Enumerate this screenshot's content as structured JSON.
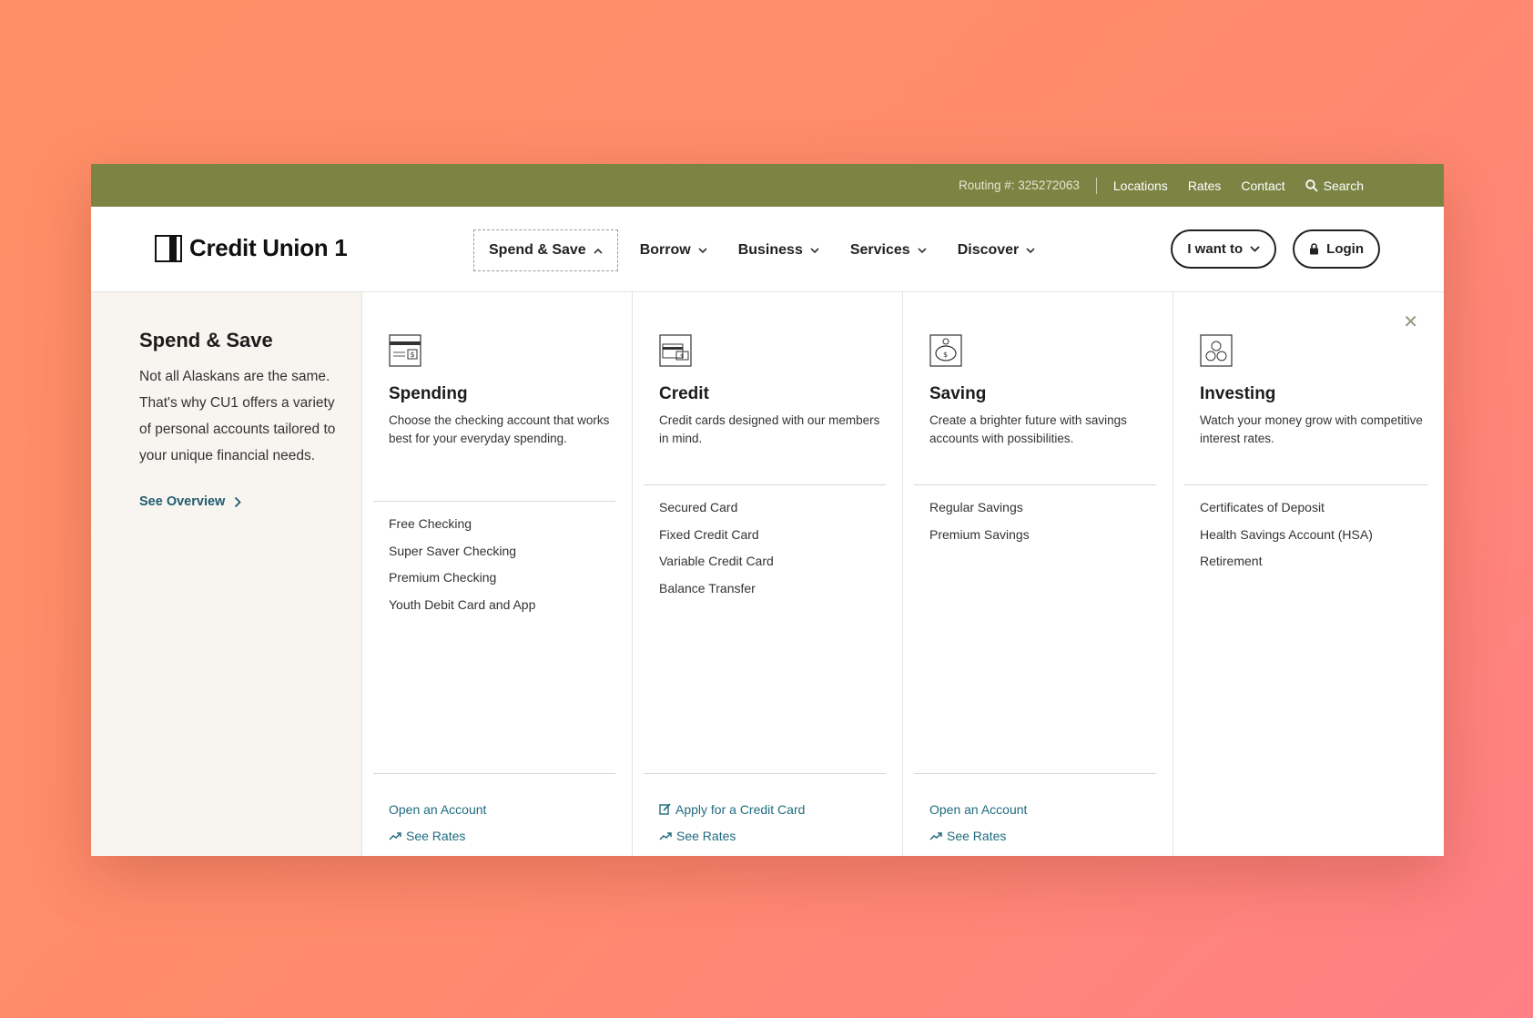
{
  "utility": {
    "routing": "Routing #: 325272063",
    "links": [
      "Locations",
      "Rates",
      "Contact"
    ],
    "search": "Search"
  },
  "brand": {
    "name": "Credit Union 1"
  },
  "nav": {
    "items": [
      {
        "label": "Spend & Save",
        "icon": "chevron-up-icon"
      },
      {
        "label": "Borrow",
        "icon": "chevron-down-icon"
      },
      {
        "label": "Business",
        "icon": "chevron-down-icon"
      },
      {
        "label": "Services",
        "icon": "chevron-down-icon"
      },
      {
        "label": "Discover",
        "icon": "chevron-down-icon"
      }
    ]
  },
  "actions": {
    "i_want_to": "I want to",
    "login": "Login"
  },
  "intro": {
    "title": "Spend & Save",
    "text": "Not all Alaskans are the same. That's why CU1 offers a variety of personal accounts tailored to your unique financial needs.",
    "overview": "See Overview"
  },
  "columns": [
    {
      "title": "Spending",
      "desc": "Choose the checking account that works best for your everyday spending.",
      "links": [
        "Free Checking",
        "Super Saver Checking",
        "Premium Checking",
        "Youth Debit Card and App"
      ],
      "footer": [
        "Open an Account",
        "See Rates"
      ]
    },
    {
      "title": "Credit",
      "desc": "Credit cards designed with our members in mind.",
      "links": [
        "Secured Card",
        "Fixed Credit Card",
        "Variable Credit Card",
        "Balance Transfer"
      ],
      "footer": [
        "Apply for a Credit Card",
        "See Rates"
      ]
    },
    {
      "title": "Saving",
      "desc": "Create a brighter future with savings accounts with possibilities.",
      "links": [
        "Regular Savings",
        "Premium Savings"
      ],
      "footer": [
        "Open an Account",
        "See Rates"
      ]
    },
    {
      "title": "Investing",
      "desc": "Watch your money grow with competitive interest rates.",
      "links": [
        "Certificates of Deposit",
        "Health Savings Account (HSA)",
        "Retirement"
      ],
      "footer": []
    }
  ],
  "colors": {
    "utility_bar": "#7c8444",
    "link": "#1f6b7e",
    "intro_bg": "#f8f5f1"
  }
}
